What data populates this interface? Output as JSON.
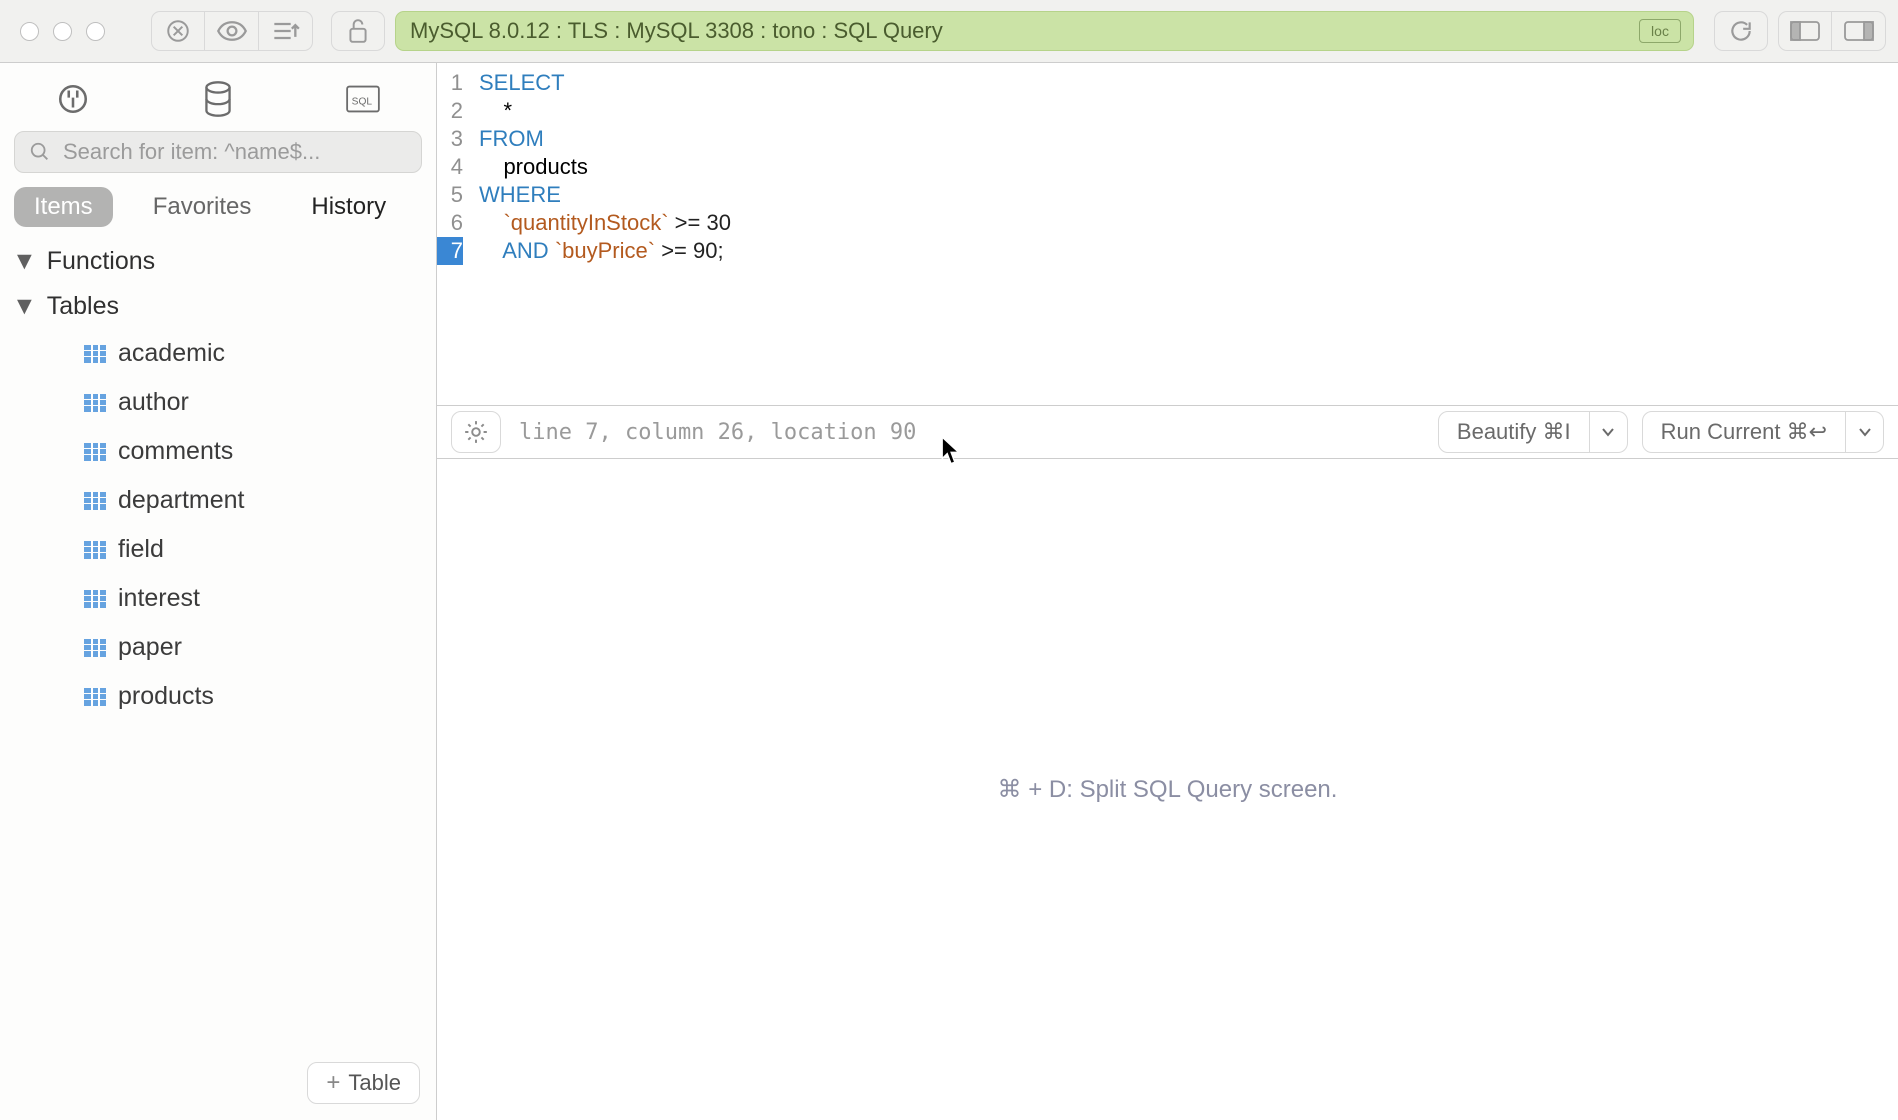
{
  "toolbar": {
    "title": "MySQL 8.0.12 : TLS : MySQL 3308 : tono : SQL Query",
    "loc_badge": "loc"
  },
  "sidebar": {
    "search_placeholder": "Search for item: ^name$...",
    "tabs": {
      "items": "Items",
      "favorites": "Favorites",
      "history": "History"
    },
    "tree": {
      "functions_label": "Functions",
      "tables_label": "Tables",
      "tables": [
        {
          "name": "academic"
        },
        {
          "name": "author"
        },
        {
          "name": "comments"
        },
        {
          "name": "department"
        },
        {
          "name": "field"
        },
        {
          "name": "interest"
        },
        {
          "name": "paper"
        },
        {
          "name": "products"
        }
      ]
    },
    "add_table_label": "Table"
  },
  "editor": {
    "lines": [
      {
        "n": 1,
        "tokens": [
          {
            "t": "SELECT",
            "c": "kw"
          }
        ]
      },
      {
        "n": 2,
        "tokens": [
          {
            "t": "    *",
            "c": ""
          }
        ]
      },
      {
        "n": 3,
        "tokens": [
          {
            "t": "FROM",
            "c": "kw"
          }
        ]
      },
      {
        "n": 4,
        "tokens": [
          {
            "t": "    products",
            "c": ""
          }
        ]
      },
      {
        "n": 5,
        "tokens": [
          {
            "t": "WHERE",
            "c": "kw"
          }
        ]
      },
      {
        "n": 6,
        "tokens": [
          {
            "t": "    `quantityInStock`",
            "c": "id"
          },
          {
            "t": " >= ",
            "c": "op"
          },
          {
            "t": "30",
            "c": "num"
          }
        ]
      },
      {
        "n": 7,
        "tokens": [
          {
            "t": "    ",
            "c": ""
          },
          {
            "t": "AND",
            "c": "kw"
          },
          {
            "t": " ",
            "c": ""
          },
          {
            "t": "`buyPrice`",
            "c": "id"
          },
          {
            "t": " >= ",
            "c": "op"
          },
          {
            "t": "90",
            "c": "num"
          },
          {
            "t": ";",
            "c": "op"
          }
        ],
        "active": true
      }
    ],
    "cursor_status": "line 7, column 26, location 90"
  },
  "actions": {
    "beautify": "Beautify ⌘I",
    "run": "Run Current ⌘↩"
  },
  "results": {
    "hint": "⌘ + D: Split SQL Query screen."
  }
}
